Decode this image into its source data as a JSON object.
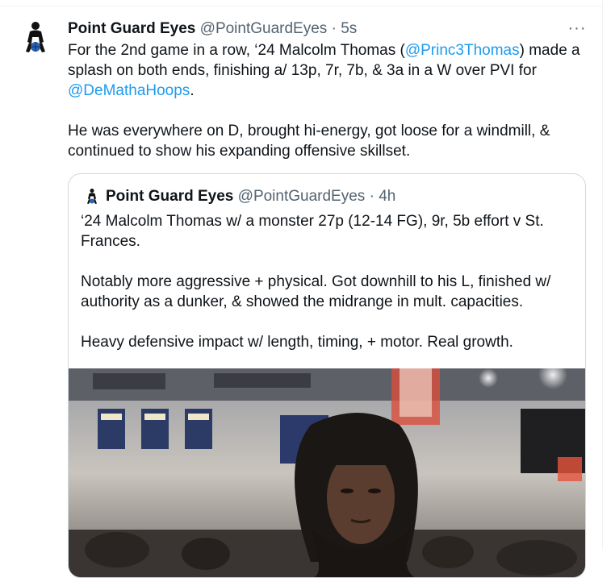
{
  "tweet": {
    "author_name": "Point Guard Eyes",
    "author_handle": "@PointGuardEyes",
    "separator": "·",
    "time": "5s",
    "more_label": "···",
    "text_p1_a": "For the 2nd game in a row, ‘24 Malcolm Thomas (",
    "mention_1": "@Princ3Thomas",
    "text_p1_b": ") made a splash on both ends, finishing a/ 13p, 7r, 7b, & 3a in a W over PVI for ",
    "mention_2": "@DeMathaHoops",
    "text_p1_c": ".",
    "text_p2": "He was everywhere on D, brought hi-energy, got loose for a windmill, & continued to show his expanding offensive skillset."
  },
  "quote": {
    "author_name": "Point Guard Eyes",
    "author_handle": "@PointGuardEyes",
    "separator": "·",
    "time": "4h",
    "text_p1": "‘24 Malcolm Thomas w/ a monster 27p (12-14 FG), 9r, 5b effort v St. Frances.",
    "text_p2": "Notably more aggressive + physical. Got downhill to his L, finished w/ authority as a dunker, & showed the midrange in mult. capacities.",
    "text_p3": "Heavy defensive impact w/ length, timing, + motor. Real growth."
  },
  "colors": {
    "link": "#1d9bf0",
    "secondary_text": "#536471",
    "border": "#cfd9de"
  },
  "icons": {
    "avatar": "basketball-player-silhouette-icon",
    "more": "more-horizontal-icon"
  }
}
